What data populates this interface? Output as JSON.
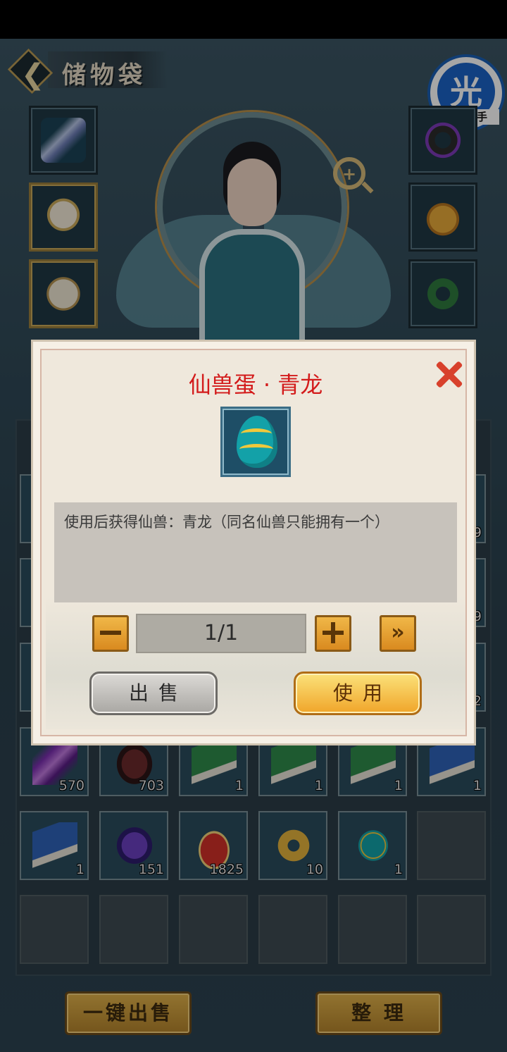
{
  "header": {
    "title": "储物袋",
    "back_icon": "chevron-left-icon"
  },
  "watermark_badge": {
    "char": "光",
    "label": "光环助手"
  },
  "equipment": {
    "left": [
      "sword-icon",
      "helmet-icon",
      "armor-icon"
    ],
    "right": [
      "ring-icon",
      "pendant-icon",
      "jade-bracelet-icon"
    ]
  },
  "bag": {
    "rows": [
      [
        {
          "icon": "purple-crystal-icon",
          "count": "570"
        },
        {
          "icon": "dark-ore-icon",
          "count": "703"
        },
        {
          "icon": "green-book-icon",
          "count": "1"
        },
        {
          "icon": "green-book-icon",
          "count": "1"
        },
        {
          "icon": "green-book-icon",
          "count": "1"
        },
        {
          "icon": "blue-book-icon",
          "count": "1"
        }
      ],
      [
        {
          "icon": "blue-book-icon",
          "count": "1"
        },
        {
          "icon": "purple-stone-icon",
          "count": "151"
        },
        {
          "icon": "red-lucky-bag-icon",
          "count": "1825"
        },
        {
          "icon": "golden-dragon-ring-icon",
          "count": "10"
        },
        {
          "icon": "beast-egg-icon",
          "count": "1"
        },
        {
          "icon": "",
          "count": ""
        }
      ]
    ],
    "partial_counts": [
      "9",
      "9",
      "2"
    ]
  },
  "footer": {
    "sell_all_label": "一键出售",
    "sort_label": "整 理"
  },
  "dialog": {
    "title": "仙兽蛋 · 青龙",
    "item_icon": "beast-egg-icon",
    "description": "使用后获得仙兽：青龙（同名仙兽只能拥有一个）",
    "quantity": "1/1",
    "sell_label": "出售",
    "use_label": "使用",
    "colors": {
      "title": "#d31b1b",
      "close": "#d8412c",
      "button_gold": "#f0b748"
    }
  }
}
